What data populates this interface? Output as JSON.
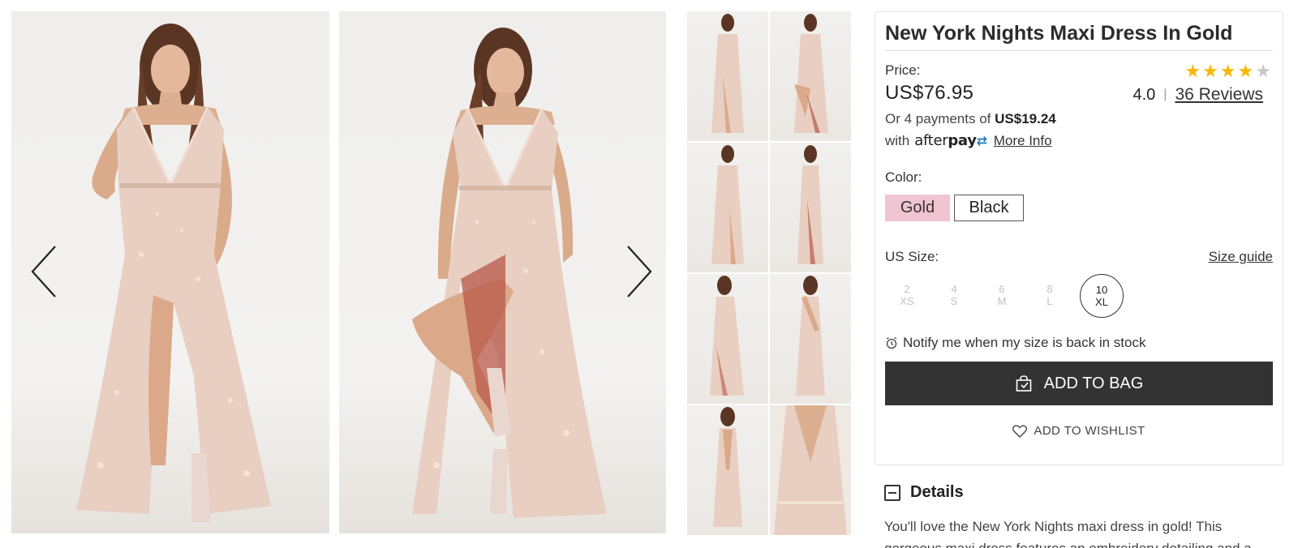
{
  "product": {
    "title": "New York Nights Maxi Dress In Gold",
    "price_label": "Price:",
    "price": "US$76.95",
    "rating": "4.0",
    "rating_separator": "|",
    "rating_stars": 4,
    "rating_max": 5,
    "reviews_link": "36 Reviews",
    "afterpay": {
      "line1_prefix": "Or 4 payments of",
      "installment": "US$19.24",
      "line2_prefix": "with",
      "logo_text_light": "after",
      "logo_text_bold": "pay",
      "more_info": "More Info"
    },
    "color_label": "Color:",
    "colors": [
      {
        "name": "Gold",
        "selected": true
      },
      {
        "name": "Black",
        "selected": false
      }
    ],
    "size_label": "US Size:",
    "size_guide": "Size guide",
    "sizes": [
      {
        "us": "2",
        "alpha": "XS",
        "available": false
      },
      {
        "us": "4",
        "alpha": "S",
        "available": false
      },
      {
        "us": "6",
        "alpha": "M",
        "available": false
      },
      {
        "us": "8",
        "alpha": "L",
        "available": false
      },
      {
        "us": "10",
        "alpha": "XL",
        "available": true
      }
    ],
    "notify": "Notify me when my size is back in stock",
    "add_to_bag": "ADD TO BAG",
    "add_to_wishlist": "ADD TO WISHLIST",
    "details_title": "Details",
    "details_text": "You'll love the New York Nights maxi dress in gold! This gorgeous maxi dress features an embroidery detailing and a"
  },
  "colors": {
    "star_filled": "#f6b800",
    "star_empty": "#c8c8c8",
    "selected_swatch": "#f1c4d1",
    "button_bg": "#333333",
    "afterpay_mark": "#1f7dbf"
  },
  "gallery": {
    "icons": {
      "prev": "chevron-left-icon",
      "next": "chevron-right-icon"
    },
    "thumbnail_count": 8
  }
}
